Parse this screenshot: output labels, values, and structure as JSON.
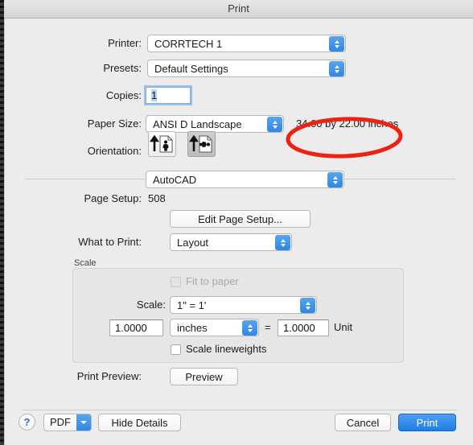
{
  "window": {
    "title": "Print"
  },
  "form": {
    "printer_label": "Printer:",
    "printer_value": "CORRTECH 1",
    "presets_label": "Presets:",
    "presets_value": "Default Settings",
    "copies_label": "Copies:",
    "copies_value": "1",
    "paper_size_label": "Paper Size:",
    "paper_size_value": "ANSI D Landscape",
    "paper_dimensions": "34.00 by 22.00 inches",
    "orientation_label": "Orientation:",
    "orientation_portrait_name": "portrait-orientation",
    "orientation_landscape_name": "landscape-orientation"
  },
  "module": {
    "selector_value": "AutoCAD",
    "page_setup_label": "Page Setup:",
    "page_setup_value": "508",
    "edit_page_setup_label": "Edit Page Setup...",
    "what_to_print_label": "What to Print:",
    "what_to_print_value": "Layout"
  },
  "scale": {
    "group_label": "Scale",
    "fit_to_paper_label": "Fit to paper",
    "fit_to_paper_checked": false,
    "fit_to_paper_enabled": false,
    "scale_label": "Scale:",
    "scale_value": "1\" = 1'",
    "numerator_value": "1.0000",
    "unit_value": "inches",
    "equals_sign": "=",
    "denominator_value": "1.0000",
    "unit_suffix": "Unit",
    "lineweights_label": "Scale lineweights",
    "lineweights_checked": false
  },
  "preview": {
    "label": "Print Preview:",
    "button_label": "Preview"
  },
  "footer": {
    "help_label": "?",
    "pdf_label": "PDF",
    "hide_details_label": "Hide Details",
    "cancel_label": "Cancel",
    "print_label": "Print"
  },
  "annotation": {
    "color": "#ee2211",
    "shape": "ellipse",
    "target": "34.00 by 22.00 inches"
  },
  "colors": {
    "dialog_background": "#ececec",
    "accent_blue": "#2f86e4",
    "primary_button": "#1f7de2",
    "annotation_red": "#ee2211"
  }
}
